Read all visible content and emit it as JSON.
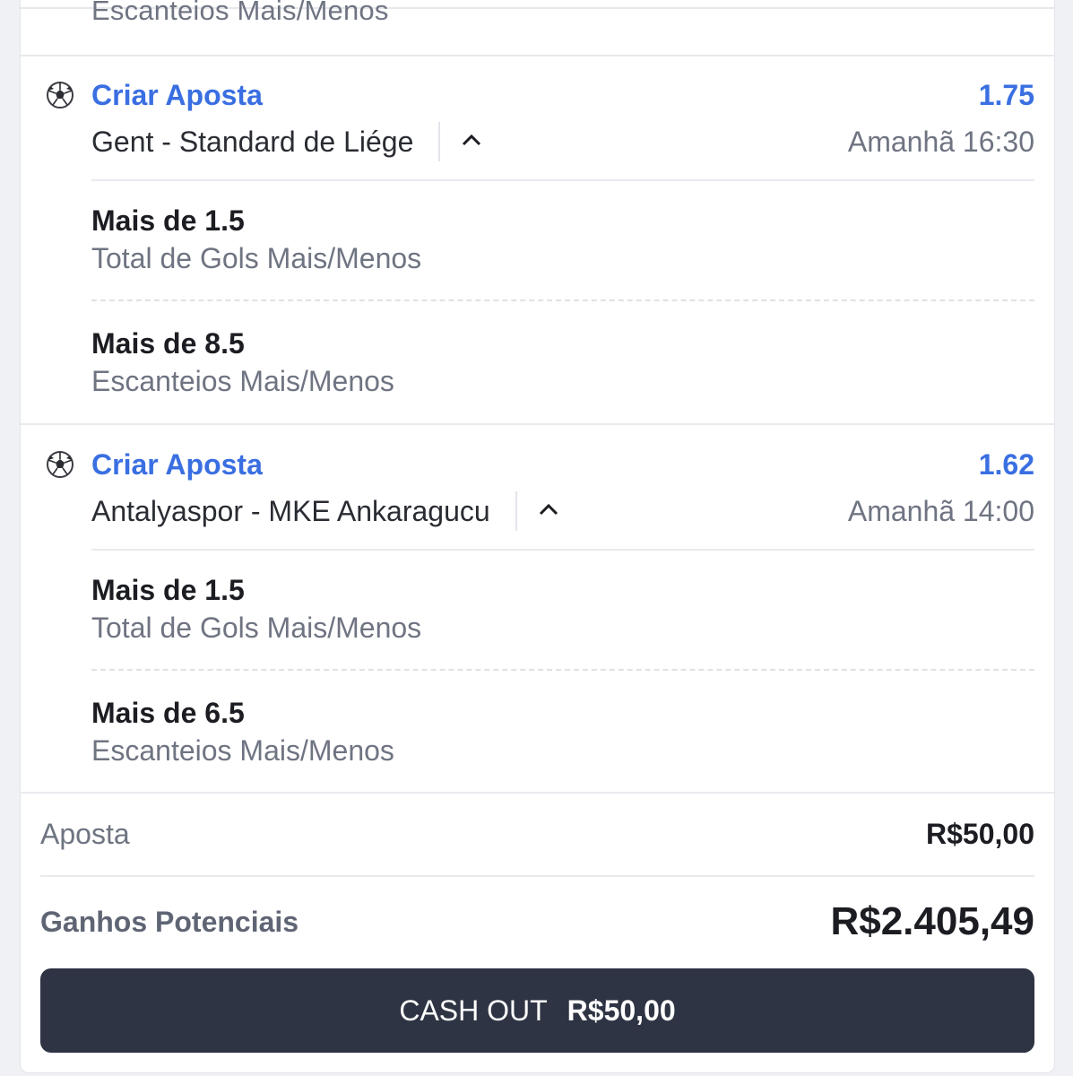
{
  "top_partial": {
    "market": "Escanteios Mais/Menos"
  },
  "legs": [
    {
      "title": "Criar Aposta",
      "odds": "1.75",
      "match": "Gent - Standard de Liége",
      "time": "Amanhã 16:30",
      "selections": [
        {
          "name": "Mais de 1.5",
          "market": "Total de Gols Mais/Menos"
        },
        {
          "name": "Mais de 8.5",
          "market": "Escanteios Mais/Menos"
        }
      ]
    },
    {
      "title": "Criar Aposta",
      "odds": "1.62",
      "match": "Antalyaspor - MKE Ankaragucu",
      "time": "Amanhã 14:00",
      "selections": [
        {
          "name": "Mais de 1.5",
          "market": "Total de Gols Mais/Menos"
        },
        {
          "name": "Mais de 6.5",
          "market": "Escanteios Mais/Menos"
        }
      ]
    }
  ],
  "summary": {
    "stake_label": "Aposta",
    "stake_value": "R$50,00",
    "potential_label": "Ganhos Potenciais",
    "potential_value": "R$2.405,49"
  },
  "cashout": {
    "label": "CASH OUT",
    "amount": "R$50,00"
  },
  "icons": {
    "sport": "soccer-ball-icon",
    "collapse": "chevron-up-icon"
  },
  "colors": {
    "accent": "#3a6fe2",
    "button": "#2e3443"
  }
}
